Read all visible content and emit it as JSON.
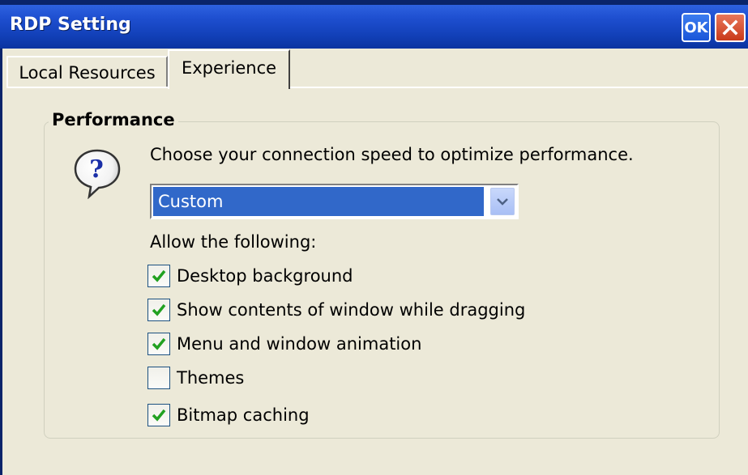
{
  "window": {
    "title": "RDP Setting",
    "ok_label": "OK"
  },
  "tabs": [
    {
      "label": "Local Resources",
      "active": false
    },
    {
      "label": "Experience",
      "active": true
    }
  ],
  "performance": {
    "group_title": "Performance",
    "prompt": "Choose your connection speed to optimize performance.",
    "speed_selected": "Custom",
    "allow_label": "Allow the following:",
    "options": [
      {
        "label": "Desktop background",
        "checked": true
      },
      {
        "label": "Show contents of window while dragging",
        "checked": true
      },
      {
        "label": "Menu and window animation",
        "checked": true
      },
      {
        "label": "Themes",
        "checked": false
      },
      {
        "label": "Bitmap caching",
        "checked": true
      }
    ]
  },
  "colors": {
    "title_bar": "#1240b8",
    "selection": "#3168c9",
    "check": "#21a121",
    "dialog_bg": "#ece9d8"
  }
}
